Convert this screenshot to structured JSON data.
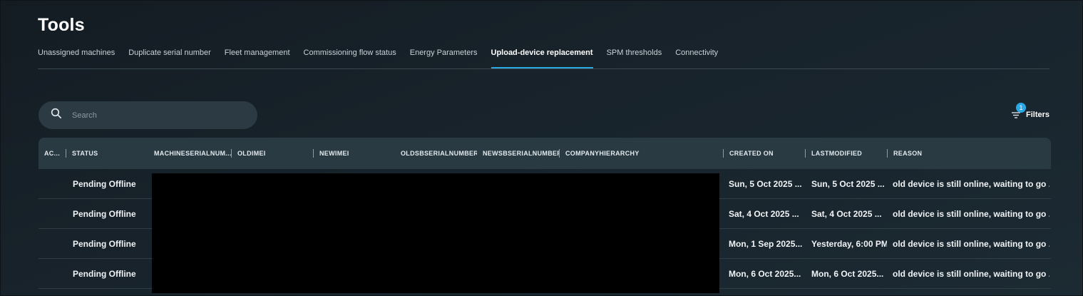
{
  "page": {
    "title": "Tools"
  },
  "tabs": [
    {
      "label": "Unassigned machines",
      "active": false
    },
    {
      "label": "Duplicate serial number",
      "active": false
    },
    {
      "label": "Fleet management",
      "active": false
    },
    {
      "label": "Commissioning flow status",
      "active": false
    },
    {
      "label": "Energy Parameters",
      "active": false
    },
    {
      "label": "Upload-device replacement",
      "active": true
    },
    {
      "label": "SPM thresholds",
      "active": false
    },
    {
      "label": "Connectivity",
      "active": false
    }
  ],
  "search": {
    "placeholder": "Search",
    "value": ""
  },
  "filters": {
    "label": "Filters",
    "count": "1"
  },
  "table": {
    "columns": [
      "AC...",
      "STATUS",
      "MACHINESERIALNUM...",
      "OLDIMEI",
      "NEWIMEI",
      "OLDSBSERIALNUMBER",
      "NEWSBSERIALNUMBER",
      "COMPANYHIERARCHY",
      "CREATED ON",
      "LASTMODIFIED",
      "REASON"
    ],
    "rows": [
      {
        "status": "Pending Offline",
        "created": "Sun, 5 Oct 2025 ...",
        "modified": "Sun, 5 Oct 2025 ...",
        "reason": "old device is still online, waiting to go ..."
      },
      {
        "status": "Pending Offline",
        "created": "Sat, 4 Oct 2025 ...",
        "modified": "Sat, 4 Oct 2025 ...",
        "reason": "old device is still online, waiting to go ..."
      },
      {
        "status": "Pending Offline",
        "created": "Mon, 1 Sep 2025...",
        "modified": "Yesterday, 6:00 PM",
        "reason": "old device is still online, waiting to go ..."
      },
      {
        "status": "Pending Offline",
        "created": "Mon, 6 Oct 2025...",
        "modified": "Mon, 6 Oct 2025...",
        "reason": "old device is still online, waiting to go ..."
      }
    ]
  },
  "colors": {
    "accent": "#29a8e0",
    "badge": "#2aa7e6",
    "header_bg": "#2a3a43"
  },
  "icons": {
    "search": "search-icon",
    "filter": "filter-icon"
  }
}
